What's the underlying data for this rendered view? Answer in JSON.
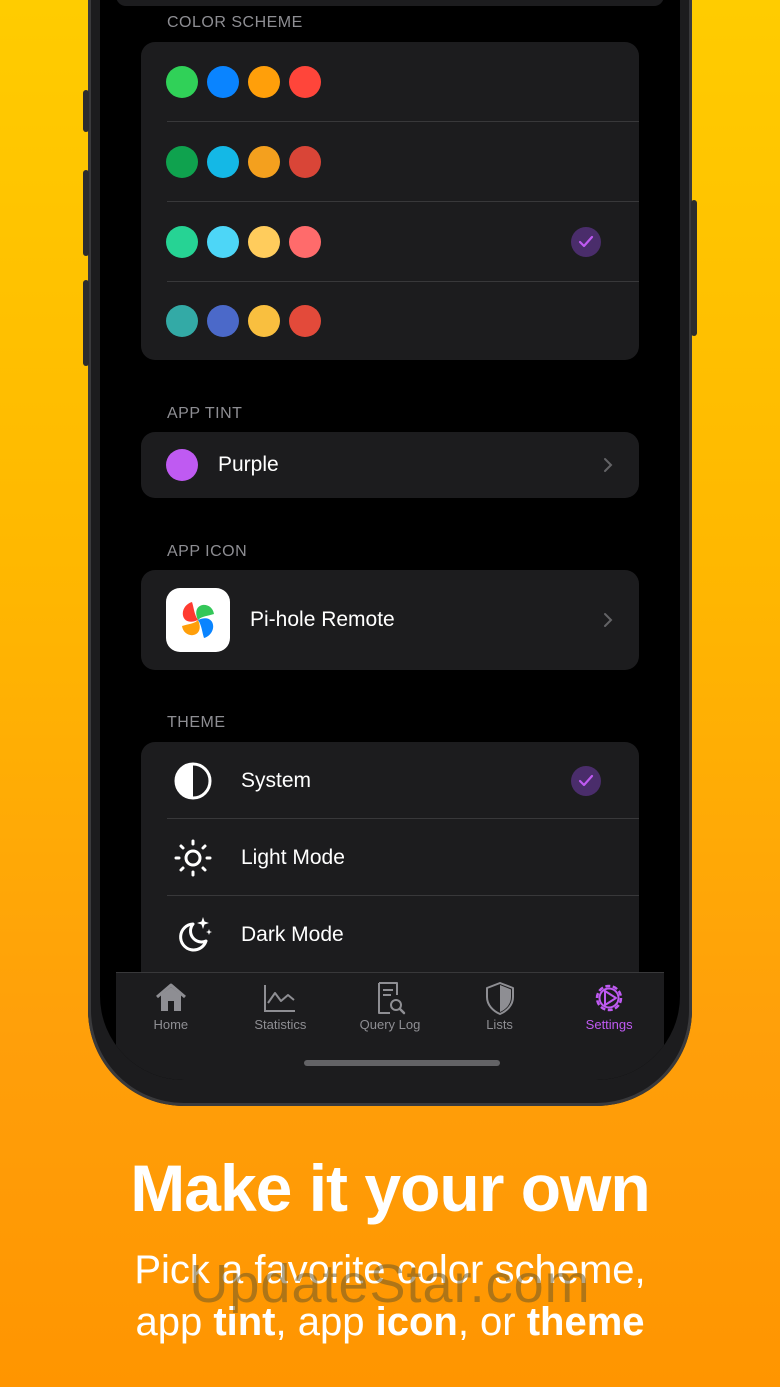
{
  "sections": {
    "color_scheme": "COLOR SCHEME",
    "app_tint": "APP TINT",
    "app_icon": "APP ICON",
    "theme": "THEME"
  },
  "color_schemes": [
    {
      "colors": [
        "#30d158",
        "#0a84ff",
        "#ff9f0a",
        "#ff453a"
      ],
      "selected": false
    },
    {
      "colors": [
        "#0fa24e",
        "#14b8e6",
        "#f4a01e",
        "#d94537"
      ],
      "selected": false
    },
    {
      "colors": [
        "#26d394",
        "#4dd6f7",
        "#ffcc5c",
        "#ff6b6b"
      ],
      "selected": true
    },
    {
      "colors": [
        "#33aaa6",
        "#4b69c9",
        "#f9bf3f",
        "#e34a3a"
      ],
      "selected": false
    }
  ],
  "app_tint": {
    "label": "Purple",
    "color": "#bf5af2"
  },
  "app_icon": {
    "label": "Pi-hole Remote"
  },
  "themes": [
    {
      "label": "System",
      "icon": "half-circle-icon",
      "selected": true
    },
    {
      "label": "Light Mode",
      "icon": "sun-icon",
      "selected": false
    },
    {
      "label": "Dark Mode",
      "icon": "moon-stars-icon",
      "selected": false
    }
  ],
  "tabs": [
    {
      "label": "Home",
      "icon": "house-icon",
      "active": false
    },
    {
      "label": "Statistics",
      "icon": "chart-icon",
      "active": false
    },
    {
      "label": "Query Log",
      "icon": "doc-search-icon",
      "active": false
    },
    {
      "label": "Lists",
      "icon": "shield-icon",
      "active": false
    },
    {
      "label": "Settings",
      "icon": "gear-icon",
      "active": true
    }
  ],
  "colors": {
    "accent": "#bf5af2",
    "inactive_tab": "#8e8e93",
    "check_bg": "#4a2d6b"
  },
  "promo": {
    "headline": "Make it your own",
    "line1": "Pick a favorite color scheme,",
    "line2_parts": [
      "app ",
      "tint",
      ", app ",
      "icon",
      ", or ",
      "theme"
    ]
  },
  "watermark": "UpdateStar.com"
}
